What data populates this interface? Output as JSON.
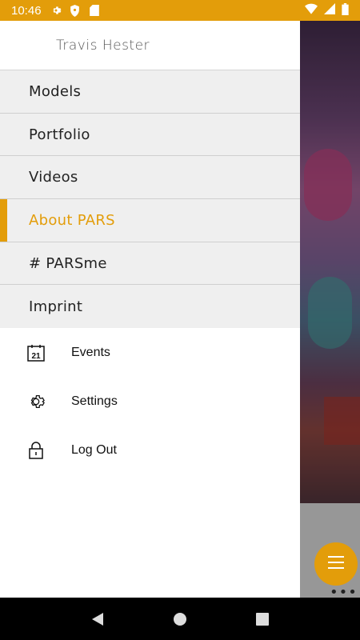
{
  "status_bar": {
    "time": "10:46",
    "left_icons": [
      "gear-icon",
      "shield-icon",
      "sd-card-icon"
    ],
    "right_icons": [
      "wifi-icon",
      "signal-icon",
      "battery-icon"
    ],
    "color": "#e39d0a"
  },
  "drawer": {
    "user_name": "Travis Hester",
    "menu": [
      {
        "label": "Models",
        "active": false
      },
      {
        "label": "Portfolio",
        "active": false
      },
      {
        "label": "Videos",
        "active": false
      },
      {
        "label": "About PARS",
        "active": true
      },
      {
        "label": "# PARSme",
        "active": false
      },
      {
        "label": "Imprint",
        "active": false
      }
    ],
    "secondary": [
      {
        "label": "Events",
        "icon": "calendar-icon",
        "icon_text": "21"
      },
      {
        "label": "Settings",
        "icon": "gear-icon"
      },
      {
        "label": "Log Out",
        "icon": "lock-icon"
      }
    ]
  },
  "accent_color": "#e39d0a",
  "background_app": {
    "fab_icon": "menu-icon",
    "more_icon": "more-horizontal-icon"
  },
  "nav_bar": {
    "buttons": [
      "back-icon",
      "home-icon",
      "recents-icon"
    ]
  }
}
